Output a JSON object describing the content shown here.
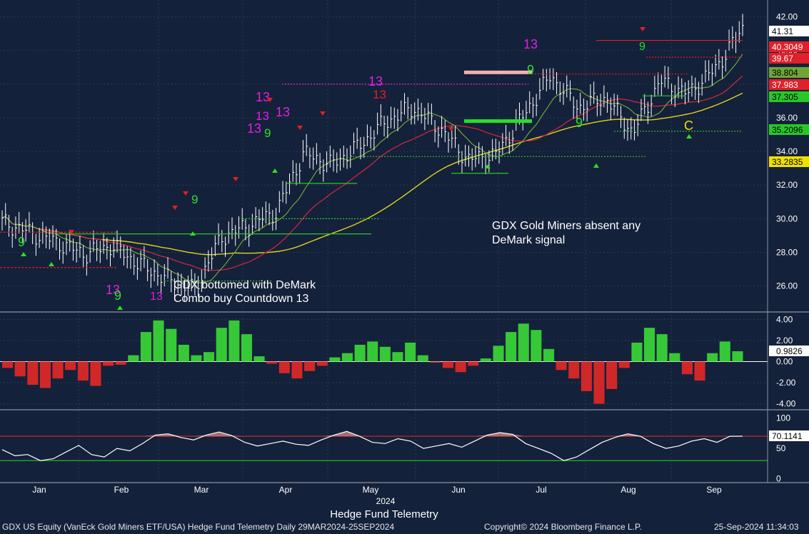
{
  "chart_data": [
    {
      "type": "candlestick",
      "panel": "price",
      "ylim": [
        24.5,
        43
      ],
      "yticks": [
        26,
        28,
        30,
        32,
        34,
        36,
        38,
        40,
        42
      ],
      "series_price": {
        "x": [
          "Jan",
          "Jan",
          "Jan",
          "Jan",
          "Jan",
          "Feb",
          "Feb",
          "Feb",
          "Mar",
          "Mar",
          "Mar",
          "Apr",
          "Apr",
          "Apr",
          "May",
          "May",
          "May",
          "Jun",
          "Jun",
          "Jun",
          "Jul",
          "Jul",
          "Jul",
          "Aug",
          "Aug",
          "Aug",
          "Sep",
          "Sep"
        ],
        "close": [
          29.8,
          29.2,
          28.6,
          27.9,
          28.4,
          27.3,
          26.4,
          25.8,
          28.9,
          29.6,
          30.4,
          33.9,
          33.2,
          34.3,
          35.8,
          36.6,
          35.3,
          33.5,
          33.8,
          36.1,
          38.5,
          36.6,
          37.2,
          35.1,
          38.2,
          37.4,
          38.9,
          41.31
        ]
      },
      "annotations": [
        {
          "text": "GDX bottomed with DeMark",
          "anchor": "Feb"
        },
        {
          "text": "Combo buy Countdown 13",
          "anchor": "Feb"
        },
        {
          "text": "GDX Gold Miners absent any",
          "anchor": "Jul"
        },
        {
          "text": "DeMark signal",
          "anchor": "Jul"
        }
      ],
      "labels": [
        {
          "value": 41.31,
          "text": "41.31",
          "color": "#ffffff",
          "text_color": "#000000"
        },
        {
          "value": 40.3049,
          "text": "40.3049",
          "color": "#e0202a",
          "text_color": "#ffffff"
        },
        {
          "value": 39.67,
          "text": "39.67",
          "color": "#e0202a",
          "text_color": "#ffffff"
        },
        {
          "value": 38.804,
          "text": "38.804",
          "color": "#6fa537",
          "text_color": "#000000"
        },
        {
          "value": 37.983,
          "text": "37.983",
          "color": "#e0202a",
          "text_color": "#ffffff"
        },
        {
          "value": 37.305,
          "text": "37.305",
          "color": "#28c828",
          "text_color": "#000000"
        },
        {
          "value": 35.2096,
          "text": "35.2096",
          "color": "#28c828",
          "text_color": "#000000"
        },
        {
          "value": 33.2835,
          "text": "33.2835",
          "color": "#f0e000",
          "text_color": "#000000"
        }
      ]
    },
    {
      "type": "bar",
      "panel": "oscillator",
      "ylim": [
        -4.5,
        4.5
      ],
      "yticks": [
        4,
        2,
        0,
        -2,
        -4
      ],
      "ytick_labels": [
        "4.00",
        "2.00",
        "0.00",
        "-2.00",
        "-4.00"
      ],
      "last_value": 0.9826,
      "last_label": "0.9826",
      "values": [
        -0.6,
        -1.4,
        -2.2,
        -2.5,
        -1.6,
        -0.8,
        -1.8,
        -2.3,
        -0.4,
        -0.3,
        0.6,
        2.8,
        3.9,
        3.1,
        1.6,
        0.6,
        0.9,
        3.2,
        3.9,
        2.6,
        0.5,
        -0.2,
        -1.1,
        -1.6,
        -0.9,
        -0.4,
        0.4,
        0.8,
        1.6,
        1.9,
        1.4,
        0.9,
        1.8,
        0.6,
        -0.1,
        -0.6,
        -1.0,
        -0.4,
        0.3,
        1.5,
        2.8,
        3.6,
        3.0,
        1.2,
        -0.8,
        -1.6,
        -2.8,
        -4.0,
        -2.6,
        -0.6,
        1.8,
        3.2,
        2.6,
        0.8,
        -1.2,
        -1.8,
        0.8,
        1.9,
        0.98
      ]
    },
    {
      "type": "line",
      "panel": "rsi",
      "ylim": [
        -5,
        110
      ],
      "yticks": [
        0,
        50,
        100
      ],
      "ytick_labels": [
        "0",
        "50",
        "100"
      ],
      "hlines": [
        70,
        30
      ],
      "last_value": 70.1141,
      "last_label": "70.1141",
      "values": [
        48,
        38,
        40,
        30,
        33,
        44,
        55,
        40,
        36,
        50,
        46,
        58,
        72,
        74,
        68,
        64,
        72,
        77,
        71,
        60,
        54,
        58,
        62,
        57,
        55,
        64,
        72,
        78,
        70,
        60,
        58,
        66,
        62,
        50,
        54,
        58,
        52,
        62,
        72,
        76,
        73,
        58,
        50,
        42,
        30,
        36,
        48,
        60,
        68,
        74,
        70,
        58,
        50,
        54,
        62,
        66,
        60,
        70,
        70.1
      ]
    }
  ],
  "x_axis": {
    "months": [
      "Jan",
      "Feb",
      "Mar",
      "Apr",
      "May",
      "Jun",
      "Jul",
      "Aug",
      "Sep"
    ],
    "year": "2024",
    "title": "Hedge Fund Telemetry"
  },
  "footer": {
    "left": "GDX US Equity (VanEck Gold Miners ETF/USA) Hedge Fund Telemetry  Daily 29MAR2024-25SEP2024",
    "center": "Copyright© 2024 Bloomberg Finance L.P.",
    "right": "25-Sep-2024 11:34:03"
  },
  "demark_labels": [
    {
      "text": "13",
      "color": "#e020e0"
    },
    {
      "text": "13",
      "color": "#e020e0"
    },
    {
      "text": "13",
      "color": "#e020e0"
    },
    {
      "text": "13",
      "color": "#e020e0"
    },
    {
      "text": "13",
      "color": "#e020e0"
    },
    {
      "text": "13",
      "color": "#e020e0"
    },
    {
      "text": "13",
      "color": "#e020e0"
    },
    {
      "text": "13",
      "color": "#e020e0"
    },
    {
      "text": "13",
      "color": "#e02020"
    },
    {
      "text": "9",
      "color": "#28e028"
    },
    {
      "text": "9",
      "color": "#28e028"
    },
    {
      "text": "9",
      "color": "#28e028"
    },
    {
      "text": "9",
      "color": "#28e028"
    },
    {
      "text": "9",
      "color": "#28e028"
    },
    {
      "text": "9",
      "color": "#28e028"
    },
    {
      "text": "9",
      "color": "#28e028"
    },
    {
      "text": "C",
      "color": "#f0e000"
    }
  ],
  "colors": {
    "background": "#14213a",
    "ma_red": "#c8283c",
    "ma_green": "#6fa537",
    "ma_yellow": "#e0d020",
    "bar_pos": "#37c837",
    "bar_neg": "#d02828"
  }
}
